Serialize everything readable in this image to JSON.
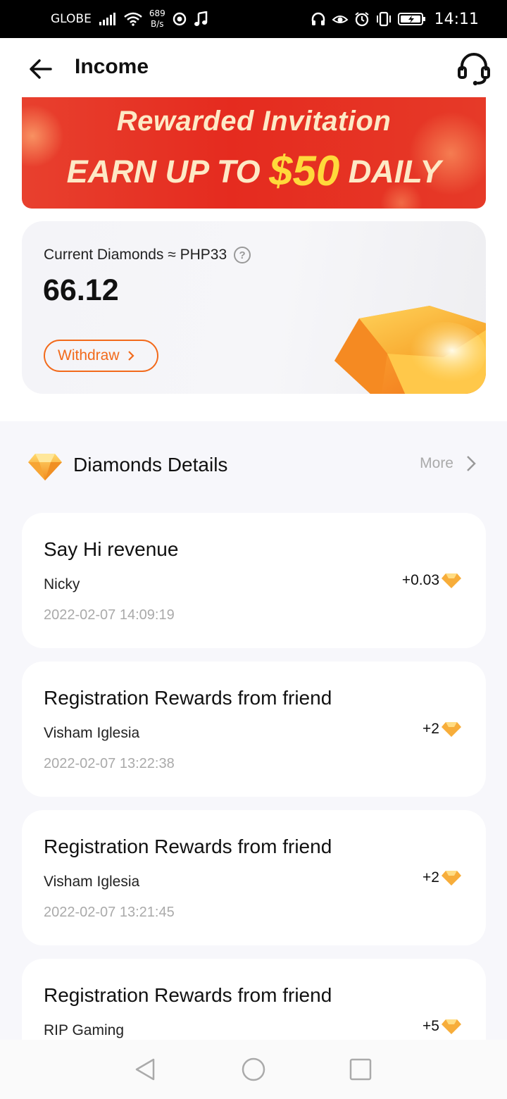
{
  "status_bar": {
    "carrier": "GLOBE",
    "net_speed_value": "689",
    "net_speed_unit": "B/s",
    "time": "14:11"
  },
  "header": {
    "title": "Income"
  },
  "banner": {
    "line1": "Rewarded Invitation",
    "line2_prefix": "EARN UP TO",
    "line2_amount": "$50",
    "line2_suffix": "DAILY"
  },
  "balance": {
    "label": "Current Diamonds ≈ PHP33",
    "value": "66.12",
    "withdraw_label": "Withdraw"
  },
  "details": {
    "title": "Diamonds Details",
    "more_label": "More",
    "records": [
      {
        "title": "Say Hi revenue",
        "name": "Nicky",
        "time": "2022-02-07 14:09:19",
        "amount": "+0.03"
      },
      {
        "title": "Registration Rewards from friend",
        "name": "Visham Iglesia",
        "time": "2022-02-07 13:22:38",
        "amount": "+2"
      },
      {
        "title": "Registration Rewards from friend",
        "name": "Visham Iglesia",
        "time": "2022-02-07 13:21:45",
        "amount": "+2"
      },
      {
        "title": "Registration Rewards from friend",
        "name": "RIP Gaming",
        "time": "",
        "amount": "+5"
      }
    ]
  },
  "colors": {
    "accent_orange": "#f26a1b",
    "banner_red": "#e52b1f",
    "banner_gold": "#ffd93b"
  },
  "icons": {
    "back": "arrow-left-icon",
    "support": "headset-icon",
    "help": "question-circle-icon",
    "diamond": "diamond-icon",
    "more": "chevron-right-icon"
  }
}
